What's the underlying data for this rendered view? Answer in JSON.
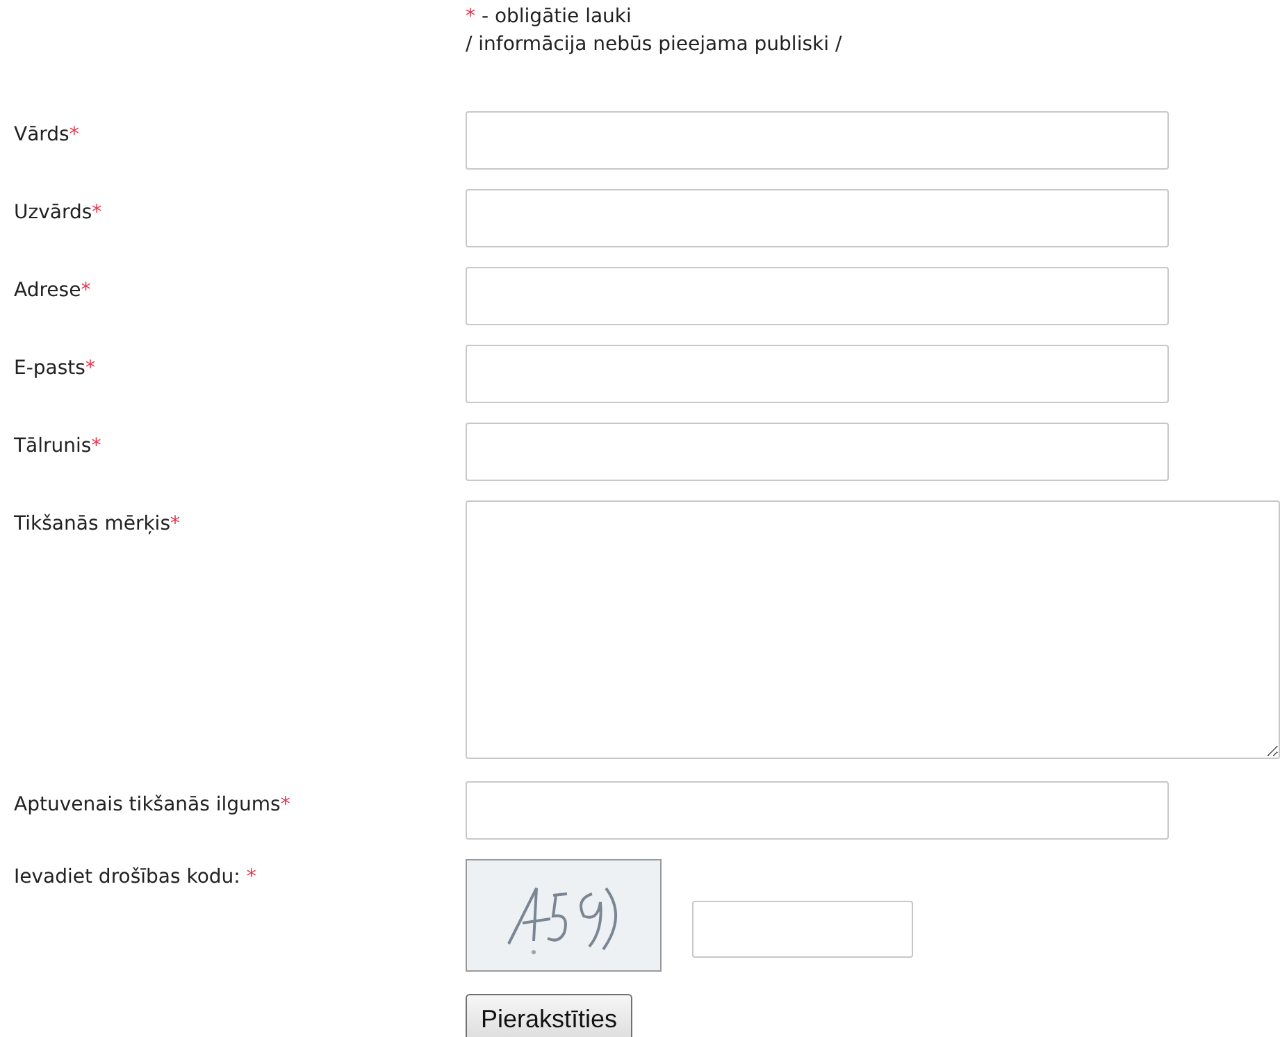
{
  "legend": {
    "mark": "*",
    "text": " - obligātie lauki",
    "note": "/ informācija nebūs pieejama publiski /"
  },
  "fields": [
    {
      "label": "Vārds",
      "mark": "*",
      "kind": "text"
    },
    {
      "label": "Uzvārds",
      "mark": "*",
      "kind": "text"
    },
    {
      "label": "Adrese",
      "mark": "*",
      "kind": "text"
    },
    {
      "label": "E-pasts",
      "mark": "*",
      "kind": "text"
    },
    {
      "label": "Tālrunis",
      "mark": "*",
      "kind": "text"
    },
    {
      "label": "Tikšanās mērķis",
      "mark": "*",
      "kind": "textarea"
    },
    {
      "label": "Aptuvenais tikšanās ilgums",
      "mark": "*",
      "kind": "text"
    }
  ],
  "captcha": {
    "label": "Ievadiet drošības kodu: ",
    "mark": "*"
  },
  "submit": "Pierakstīties"
}
